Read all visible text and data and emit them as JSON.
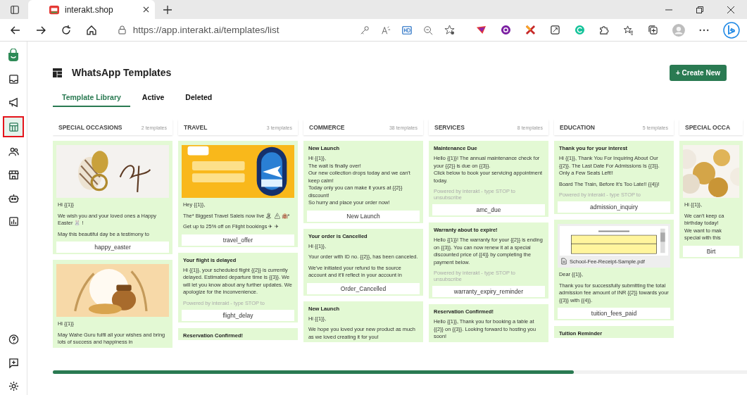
{
  "browser": {
    "tab": {
      "title": "interakt.shop"
    },
    "url": "https://app.interakt.ai/templates/list"
  },
  "sidebar": {
    "items": [
      {
        "selected": false
      },
      {
        "selected": false
      },
      {
        "selected": true
      },
      {
        "selected": false
      },
      {
        "selected": false
      },
      {
        "selected": false
      },
      {
        "selected": false
      }
    ],
    "bottom_items": [
      {
        "selected": false
      },
      {
        "selected": false
      },
      {
        "selected": false
      }
    ]
  },
  "page": {
    "title": "WhatsApp Templates",
    "create_button": "+ Create New"
  },
  "tabs": [
    {
      "label": "Template Library",
      "selected": true
    },
    {
      "label": "Active",
      "selected": false
    },
    {
      "label": "Deleted",
      "selected": false
    }
  ],
  "columns": [
    {
      "name": "SPECIAL OCCASIONS",
      "count": "2 templates",
      "cards": [
        {
          "paragraphs": [
            "Hi {{1}}",
            "We wish you and your loved ones a Happy Easter 🐰 !",
            "May this beautiful day be a testimony to"
          ],
          "name": "happy_easter"
        },
        {
          "paragraphs": [
            "Hi {{1}}",
            "May Wahe Guru fulfil all your wishes and bring lots of success and happiness in"
          ]
        }
      ]
    },
    {
      "name": "TRAVEL",
      "count": "3 templates",
      "cards": [
        {
          "paragraphs": [
            "Hey {{1}},",
            "The* Biggest Travel Saleis now live 🏝 ⚠ 🏨*",
            "Get up to 25% off on Flight bookings ✈ ✈"
          ],
          "name": "travel_offer"
        },
        {
          "kind": "text",
          "title": "Your flight is delayed",
          "paragraphs": [
            "Hi {{1}}, your scheduled flight {{2}} is currently delayed. Estimated departure time is {{3}}. We will let you know about any further updates. We apologize for the inconvenience."
          ],
          "footer": "Powered by interakt - type STOP to",
          "name": "flight_delay"
        },
        {
          "kind": "text",
          "title": "Reservation Confirmed!"
        }
      ]
    },
    {
      "name": "COMMERCE",
      "count": "38 templates",
      "cards": [
        {
          "kind": "text",
          "title": "New Launch",
          "paragraphs": [
            "Hi {{1}},\nThe wait is finally over!\nOur new collection drops today and we can't keep calm!\nToday only you can make it yours at {{2}} discount!\nSo hurry and place your order now!"
          ],
          "name": "New Launch"
        },
        {
          "kind": "text",
          "title": "Your order is Cancelled",
          "paragraphs": [
            "Hi {{1}},",
            "Your order with ID no. {{2}}, has been canceled.",
            "We've initiated your refund to the source account and it'll reflect in your account in"
          ],
          "name": "Order_Cancelled"
        },
        {
          "kind": "text",
          "title": "New Launch",
          "paragraphs": [
            "Hi {{1}},",
            "We hope you loved your new product as much as we loved creating it for you!"
          ]
        }
      ]
    },
    {
      "name": "SERVICES",
      "count": "8 templates",
      "cards": [
        {
          "kind": "text",
          "title": "Maintenance Due",
          "paragraphs": [
            "Hello {{1}}! The annual maintenance check for your {{2}} is due on {{3}}.\nClick below to book your servicing appointment today."
          ],
          "footer": "Powered by interakt - type STOP to unsubscribe",
          "name": "amc_due"
        },
        {
          "kind": "text",
          "title": "Warranty about to expire!",
          "paragraphs": [
            "Hello {{1}}! The warranty for your {{2}} is ending on {{3}}. You can now renew it at a special discounted price of {{4}} by completing the payment below."
          ],
          "footer": "Powered by interakt - type STOP to unsubscribe",
          "name": "warranty_expiry_reminder"
        },
        {
          "kind": "text",
          "title": "Reservation Confirmed!",
          "paragraphs": [
            "Hello {{1}}, Thank you for booking a table at {{2}} on {{3}}. Looking forward to hosting you soon!"
          ]
        }
      ]
    },
    {
      "name": "EDUCATION",
      "count": "5 templates",
      "cards": [
        {
          "kind": "text",
          "title": "Thank you for your interest",
          "paragraphs": [
            "Hi {{1}}, Thank You For Inquiring About Our {{2}}. The Last Date For Admissions Is {{3}}. Only a Few Seats Left!!",
            "Board The Train, Before It's Too Late!! {{4}}!"
          ],
          "footer": "Powered by interakt - type STOP to",
          "name": "admission_inquiry"
        },
        {
          "kind": "document",
          "file": "School-Fee-Receipt-Sample.pdf",
          "paragraphs": [
            "Dear {{1}},",
            "Thank you for successfully submitting the total admission fee amount of INR {{2}} towards your {{3}} with {{4}}."
          ],
          "name": "tuition_fees_paid"
        },
        {
          "kind": "text",
          "title": "Tuition Reminder"
        }
      ]
    },
    {
      "name": "SPECIAL OCCA",
      "cards": [
        {
          "paragraphs": [
            "Hi {{1}},",
            "We can't keep ca\nbirthday today!\nWe want to mak\nspecial with this"
          ],
          "name": "Birt"
        }
      ]
    }
  ]
}
